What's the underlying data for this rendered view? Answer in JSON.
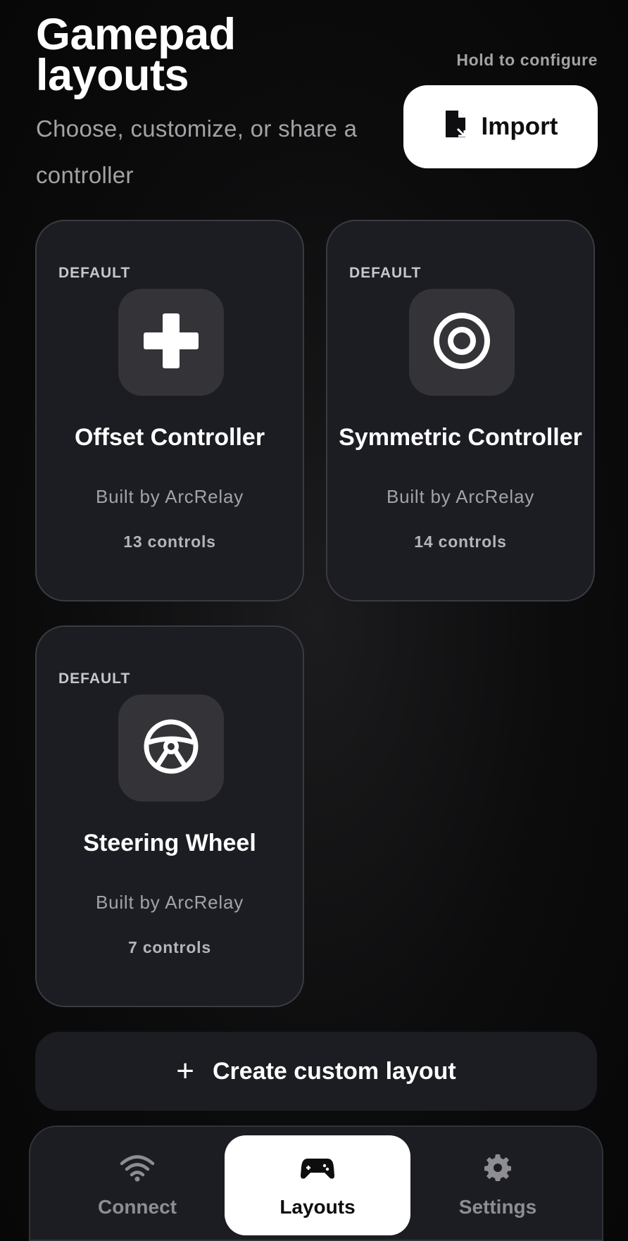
{
  "header": {
    "title": "Gamepad layouts",
    "subtitle": "Choose, customize, or share a controller",
    "hold_hint": "Hold to configure",
    "import_label": "Import",
    "import_icon": "file-import-icon"
  },
  "layouts": [
    {
      "badge": "DEFAULT",
      "name": "Offset Controller",
      "author": "Built by ArcRelay",
      "controls": "13 controls",
      "icon": "dpad-icon"
    },
    {
      "badge": "DEFAULT",
      "name": "Symmetric Controller",
      "author": "Built by ArcRelay",
      "controls": "14 controls",
      "icon": "target-icon"
    },
    {
      "badge": "DEFAULT",
      "name": "Steering Wheel",
      "author": "Built by ArcRelay",
      "controls": "7 controls",
      "icon": "steering-wheel-icon"
    }
  ],
  "create": {
    "label": "Create custom layout",
    "icon": "plus-icon"
  },
  "nav": {
    "items": [
      {
        "label": "Connect",
        "icon": "wifi-icon"
      },
      {
        "label": "Layouts",
        "icon": "gamepad-icon",
        "active": true
      },
      {
        "label": "Settings",
        "icon": "gear-icon"
      }
    ]
  },
  "colors": {
    "background": "#0c0c0d",
    "card": "#1c1d22",
    "accent": "#ffffff",
    "muted": "#a3a3a7"
  }
}
